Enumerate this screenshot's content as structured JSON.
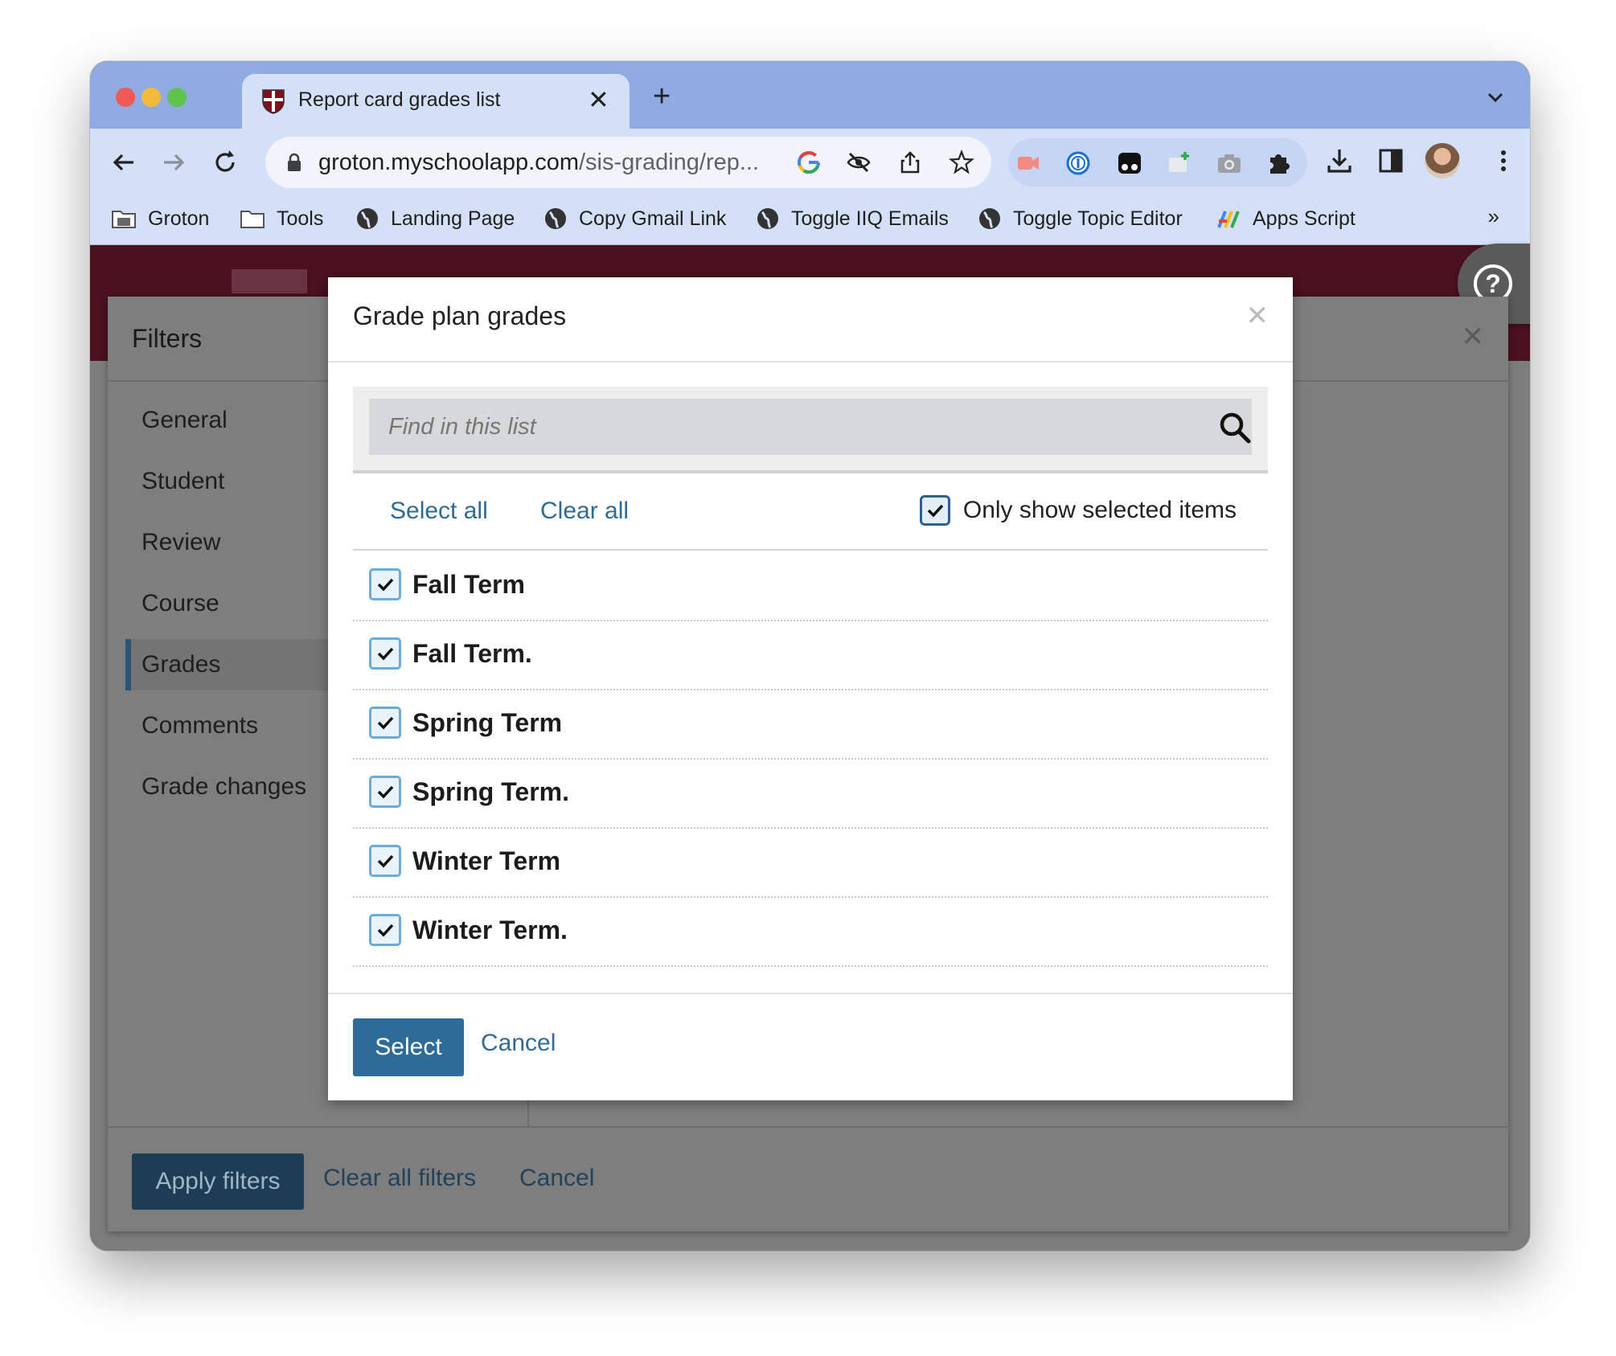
{
  "browser": {
    "tab_title": "Report card grades list",
    "url_host": "groton.myschoolapp.com",
    "url_path": "/sis-grading/rep...",
    "bookmarks": [
      {
        "label": "Groton",
        "icon": "building-folder-icon"
      },
      {
        "label": "Tools",
        "icon": "folder-icon"
      },
      {
        "label": "Landing Page",
        "icon": "globe-icon"
      },
      {
        "label": "Copy Gmail Link",
        "icon": "globe-icon"
      },
      {
        "label": "Toggle IIQ Emails",
        "icon": "globe-icon"
      },
      {
        "label": "Toggle Topic Editor",
        "icon": "globe-icon"
      },
      {
        "label": "Apps Script",
        "icon": "apps-script-icon"
      }
    ],
    "bookmarks_overflow": "»"
  },
  "filters": {
    "title": "Filters",
    "nav": [
      {
        "label": "General",
        "active": false
      },
      {
        "label": "Student",
        "active": false
      },
      {
        "label": "Review",
        "active": false
      },
      {
        "label": "Course",
        "active": false
      },
      {
        "label": "Grades",
        "active": true
      },
      {
        "label": "Comments",
        "active": false
      },
      {
        "label": "Grade changes",
        "active": false
      }
    ],
    "apply_label": "Apply filters",
    "clear_label": "Clear all filters",
    "cancel_label": "Cancel"
  },
  "modal": {
    "title": "Grade plan grades",
    "search_placeholder": "Find in this list",
    "select_all_label": "Select all",
    "clear_all_label": "Clear all",
    "only_show_label": "Only show selected items",
    "only_show_checked": true,
    "items": [
      {
        "label": "Fall Term",
        "checked": true
      },
      {
        "label": "Fall Term.",
        "checked": true
      },
      {
        "label": "Spring Term",
        "checked": true
      },
      {
        "label": "Spring Term.",
        "checked": true
      },
      {
        "label": "Winter Term",
        "checked": true
      },
      {
        "label": "Winter Term.",
        "checked": true
      }
    ],
    "select_label": "Select",
    "cancel_label": "Cancel"
  },
  "colors": {
    "tabstrip": "#8fabe2",
    "toolbar": "#d4e0f8",
    "header_maroon": "#4a111f",
    "primary_button": "#2d6b98",
    "link": "#2f6b94"
  }
}
